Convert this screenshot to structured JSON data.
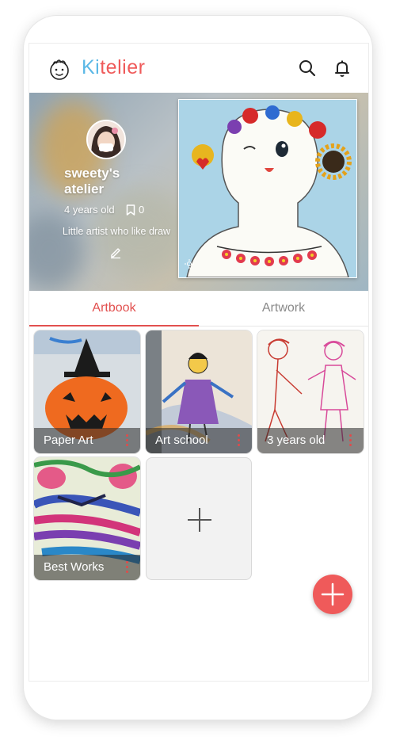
{
  "header": {
    "brand_k": "Ki",
    "brand_rest": "telier"
  },
  "profile": {
    "name": "sweety's atelier",
    "age": "4 years old",
    "bookmark_count": "0",
    "bio": "Little artist who like draw"
  },
  "tabs": [
    {
      "label": "Artbook"
    },
    {
      "label": "Artwork"
    }
  ],
  "artbooks": [
    {
      "title": "Paper Art"
    },
    {
      "title": "Art school"
    },
    {
      "title": "3 years old"
    },
    {
      "title": "Best Works"
    }
  ],
  "colors": {
    "accent": "#ef5a5a",
    "brand_blue": "#5bb8e6"
  },
  "icons": [
    "kid-face-logo-icon",
    "search-icon",
    "bell-icon",
    "bookmark-icon",
    "edit-icon",
    "sun-icon",
    "plus-icon",
    "more-dots-icon"
  ]
}
